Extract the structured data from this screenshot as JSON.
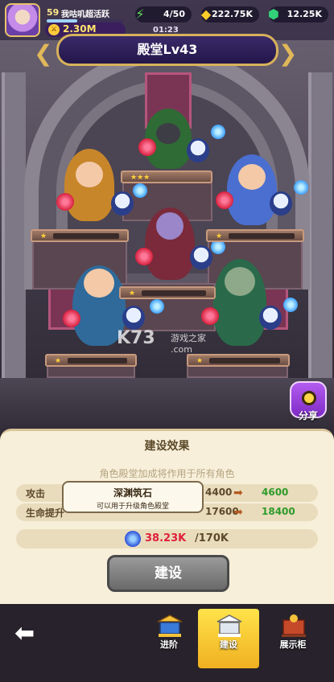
{
  "player": {
    "level": "59",
    "guild_status": "我咕叽超活跃",
    "power": "2.30M"
  },
  "resources": {
    "stamina": {
      "value": "4/50",
      "icon": "lightning-icon"
    },
    "gold": {
      "value": "222.75K",
      "icon": "gold-coin-icon"
    },
    "gems": {
      "value": "12.25K",
      "icon": "green-gem-icon"
    }
  },
  "timer": "01:23",
  "hall": {
    "title": "殿堂Lv43"
  },
  "watermark": {
    "main": "K73",
    "sub": "游戏之家",
    "domain": ".com"
  },
  "share": {
    "label": "分享"
  },
  "panel": {
    "title": "建设效果",
    "subtitle": "角色殿堂加成将作用于所有角色",
    "stats": [
      {
        "label": "攻击",
        "from": "4400",
        "to": "4600"
      },
      {
        "label": "生命提升",
        "from": "17600",
        "to": "18400"
      }
    ],
    "cost": {
      "have": "38.23K",
      "need": "/170K"
    },
    "build_button": "建设"
  },
  "tooltip": {
    "title": "深渊筑石",
    "desc": "可以用于升级角色殿堂"
  },
  "nav": {
    "tabs": [
      {
        "label": "进阶",
        "active": false
      },
      {
        "label": "建设",
        "active": true
      },
      {
        "label": "展示柜",
        "active": false
      }
    ]
  },
  "colors": {
    "accent": "#f0b020",
    "increase": "#2e9a2a",
    "insufficient": "#e0203a"
  }
}
